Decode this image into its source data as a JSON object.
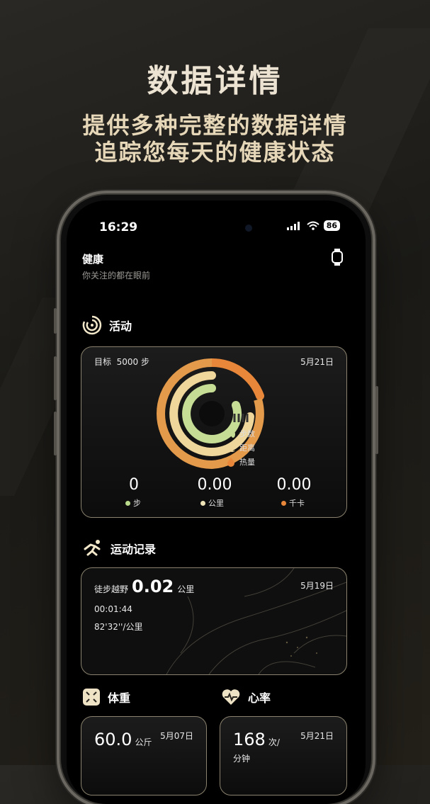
{
  "promo": {
    "headline": "数据详情",
    "line1": "提供多种完整的数据详情",
    "line2": "追踪您每天的健康状态"
  },
  "status_bar": {
    "time": "16:29",
    "battery": "86"
  },
  "header": {
    "title": "健康",
    "subtitle": "你关注的都在眼前",
    "watch_icon": "watch-icon"
  },
  "activity": {
    "section_title": "活动",
    "goal_label": "目标",
    "goal_value": "5000 步",
    "date": "5月21日",
    "legend": [
      {
        "label": "步数",
        "icon": "footprint-icon"
      },
      {
        "label": "距离",
        "icon": "moon-icon"
      },
      {
        "label": "热量",
        "icon": "flame-icon"
      }
    ],
    "stats": [
      {
        "value": "0",
        "unit": "步",
        "color": "#b9d98b"
      },
      {
        "value": "0.00",
        "unit": "公里",
        "color": "#efe3b8"
      },
      {
        "value": "0.00",
        "unit": "千卡",
        "color": "#e8873a"
      }
    ],
    "ring_colors": [
      "#e8873a",
      "#efd79c",
      "#c6dd95"
    ]
  },
  "workout": {
    "section_title": "运动记录",
    "type": "徒步越野",
    "distance": "0.02",
    "distance_unit": "公里",
    "date": "5月19日",
    "duration": "00:01:44",
    "pace": "82'32''/公里"
  },
  "weight": {
    "section_title": "体重",
    "value": "60.0",
    "unit": "公斤",
    "date": "5月07日"
  },
  "heart": {
    "section_title": "心率",
    "value": "168",
    "unit_top": "次/",
    "unit_bottom": "分钟",
    "date": "5月21日"
  }
}
